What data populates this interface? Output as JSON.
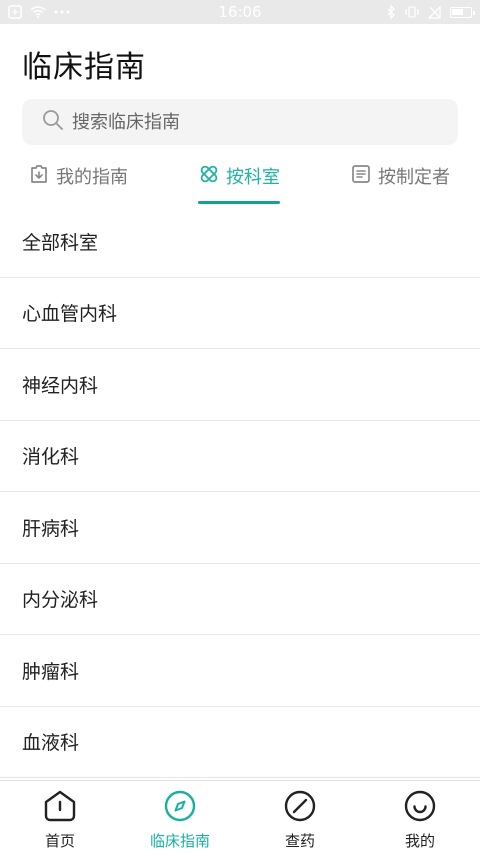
{
  "status_bar": {
    "time": "16:06"
  },
  "header": {
    "title": "临床指南"
  },
  "search": {
    "placeholder": "搜索临床指南"
  },
  "tabs": [
    {
      "label": "我的指南",
      "icon": "folder-icon",
      "active": false
    },
    {
      "label": "按科室",
      "icon": "bandage-icon",
      "active": true
    },
    {
      "label": "按制定者",
      "icon": "document-icon",
      "active": false
    }
  ],
  "departments": [
    "全部科室",
    "心血管内科",
    "神经内科",
    "消化科",
    "肝病科",
    "内分泌科",
    "肿瘤科",
    "血液科"
  ],
  "bottom_nav": [
    {
      "label": "首页",
      "icon": "home-icon",
      "active": false
    },
    {
      "label": "临床指南",
      "icon": "compass-icon",
      "active": true
    },
    {
      "label": "查药",
      "icon": "pill-icon",
      "active": false
    },
    {
      "label": "我的",
      "icon": "smile-icon",
      "active": false
    }
  ],
  "colors": {
    "accent": "#1fb3a4",
    "underline": "#11a394",
    "divider": "#e6e6e6",
    "search_bg": "#f4f4f4"
  }
}
